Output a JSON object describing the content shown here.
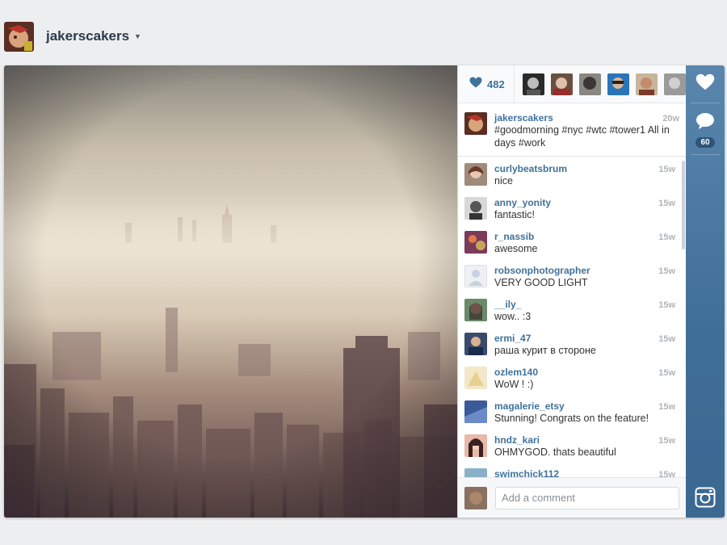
{
  "header": {
    "username": "jakerscakers"
  },
  "likes": {
    "count": "482",
    "accent": "#3f729b"
  },
  "caption": {
    "username": "jakerscakers",
    "time": "20w",
    "text": "#goodmorning #nyc #wtc #tower1 All in days #work"
  },
  "comments": [
    {
      "username": "curlybeatsbrum",
      "time": "15w",
      "text": "nice"
    },
    {
      "username": "anny_yonity",
      "time": "15w",
      "text": "fantastic!"
    },
    {
      "username": "r_nassib",
      "time": "15w",
      "text": "awesome"
    },
    {
      "username": "robsonphotographer",
      "time": "15w",
      "text": "VERY GOOD LIGHT"
    },
    {
      "username": "__ily_",
      "time": "15w",
      "text": "wow.. :3"
    },
    {
      "username": "ermi_47",
      "time": "15w",
      "text": "раша курит в стороне"
    },
    {
      "username": "ozlem140",
      "time": "15w",
      "text": "WoW ! :)"
    },
    {
      "username": "magalerie_etsy",
      "time": "15w",
      "text": "Stunning! Congrats on the feature!"
    },
    {
      "username": "hndz_kari",
      "time": "15w",
      "text": "OHMYGOD. thats beautiful"
    },
    {
      "username": "swimchick112",
      "time": "15w",
      "text": ""
    }
  ],
  "composer": {
    "placeholder": "Add a comment"
  },
  "actions": {
    "comment_count": "60"
  },
  "icons": {
    "like": "heart-icon",
    "comment": "speech-bubble-icon",
    "instagram": "camera-icon",
    "dropdown": "caret-down-icon"
  }
}
